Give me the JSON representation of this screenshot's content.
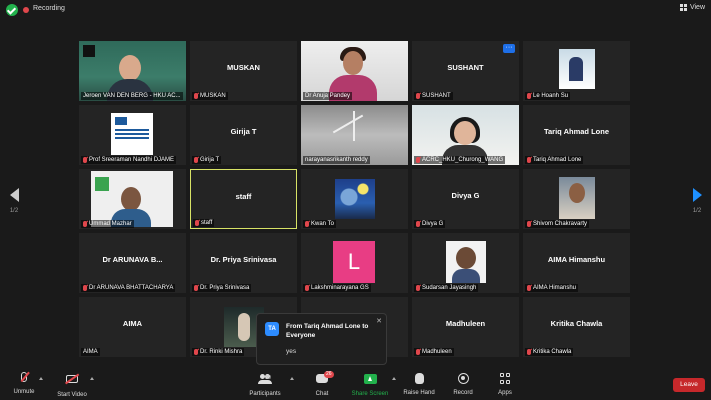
{
  "topbar": {
    "recording_label": "Recording",
    "view_label": "View"
  },
  "pagination": {
    "left_page": "1/2",
    "right_page": "1/2"
  },
  "tiles": [
    {
      "name": "Jeroen VAN DEN BERG - HKU AC...",
      "display": "",
      "muted": false
    },
    {
      "name": "MUSKAN",
      "display": "MUSKAN",
      "muted": true
    },
    {
      "name": "Dr Anuja Pandey",
      "display": "",
      "muted": false
    },
    {
      "name": "SUSHANT",
      "display": "SUSHANT",
      "muted": true
    },
    {
      "name": "Le Hoanh Su",
      "display": "",
      "muted": true
    },
    {
      "name": "Prof Sreeraman Nandhi DJAME",
      "display": "",
      "muted": true
    },
    {
      "name": "Girija T",
      "display": "Girija T",
      "muted": true
    },
    {
      "name": "narayanasrikanth reddy",
      "display": "",
      "muted": false
    },
    {
      "name": "ACRC_HKU_Churong_WANG",
      "display": "",
      "muted": true
    },
    {
      "name": "Tariq Ahmad Lone",
      "display": "Tariq Ahmad Lone",
      "muted": true
    },
    {
      "name": "Ummad Mazhar",
      "display": "",
      "muted": true
    },
    {
      "name": "staff",
      "display": "staff",
      "muted": true
    },
    {
      "name": "Kwan To",
      "display": "",
      "muted": true
    },
    {
      "name": "Divya G",
      "display": "Divya G",
      "muted": true
    },
    {
      "name": "Shivom Chakravarty",
      "display": "",
      "muted": true
    },
    {
      "name": "Dr ARUNAVA BHATTACHARYA",
      "display": "Dr ARUNAVA B...",
      "muted": true
    },
    {
      "name": "Dr. Priya Srinivasa",
      "display": "Dr. Priya Srinivasa",
      "muted": true
    },
    {
      "name": "Lakshminarayana GS",
      "display": "",
      "avatar_letter": "L",
      "avatar_color": "#e83d84",
      "muted": true
    },
    {
      "name": "Sudarsan Jayasingh",
      "display": "",
      "muted": true
    },
    {
      "name": "AIMA Himanshu",
      "display": "AIMA Himanshu",
      "muted": true
    },
    {
      "name": "AIMA",
      "display": "AIMA",
      "muted": false
    },
    {
      "name": "Dr. Rinki Mishra",
      "display": "",
      "muted": true
    },
    {
      "name": "",
      "display": "",
      "muted": false
    },
    {
      "name": "Madhuleen",
      "display": "Madhuleen",
      "muted": true
    },
    {
      "name": "Kritika Chawla",
      "display": "Kritika Chawla",
      "muted": true
    }
  ],
  "chat_popup": {
    "initials": "TA",
    "from": "From Tariq Ahmad Lone to Everyone",
    "message": "yes"
  },
  "toolbar": {
    "unmute": "Unmute",
    "start_video": "Start Video",
    "participants": "Participants",
    "participants_count": "39",
    "chat": "Chat",
    "chat_badge": "26",
    "share_screen": "Share Screen",
    "raise_hand": "Raise Hand",
    "record": "Record",
    "apps": "Apps",
    "leave": "Leave"
  },
  "colors": {
    "accent": "#2d8cff",
    "share": "#22b14c",
    "leave": "#c6282b",
    "active_speaker": "#d8e366",
    "muted": "#e0474c"
  }
}
